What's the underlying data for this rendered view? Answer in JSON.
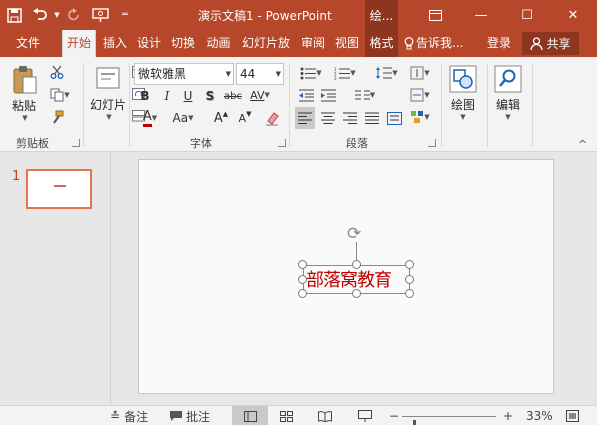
{
  "window": {
    "title": "演示文稿1 - PowerPoint",
    "context_tab": "绘...",
    "ribbon_display_icon": "ribbon-display-icon",
    "minimize_glyph": "—",
    "maximize_glyph": "☐",
    "close_glyph": "✕"
  },
  "qat": {
    "save_icon": "save-icon",
    "undo_icon": "undo-icon",
    "redo_icon": "redo-icon",
    "start_from_beginning_icon": "slideshow-icon",
    "customize_icon": "customize-qat-icon"
  },
  "tabs": [
    {
      "label": "文件"
    },
    {
      "label": "开始",
      "active": true
    },
    {
      "label": "插入"
    },
    {
      "label": "设计"
    },
    {
      "label": "切换"
    },
    {
      "label": "动画"
    },
    {
      "label": "幻灯片放"
    },
    {
      "label": "审阅"
    },
    {
      "label": "视图"
    },
    {
      "label": "格式"
    },
    {
      "label": "告诉我..."
    },
    {
      "label": "登录"
    }
  ],
  "share": {
    "label": "共享"
  },
  "ribbon": {
    "clipboard": {
      "group_label": "剪贴板",
      "paste_label": "粘贴"
    },
    "slides": {
      "new_slide_label": "幻灯片"
    },
    "font": {
      "group_label": "字体",
      "font_name": "微软雅黑",
      "font_size": "44",
      "bold": "B",
      "italic": "I",
      "underline": "U",
      "shadow": "S",
      "strike": "abc",
      "spacing": "AV",
      "font_color_letter": "A",
      "change_case": "Aa",
      "grow": "A",
      "shrink": "A"
    },
    "paragraph": {
      "group_label": "段落"
    },
    "drawing": {
      "label": "绘图"
    },
    "editing": {
      "label": "编辑"
    }
  },
  "thumbnails": [
    {
      "number": "1"
    }
  ],
  "slide": {
    "textbox_text": "部落窝教育",
    "text_color": "#c00000"
  },
  "status": {
    "notes_label": "备注",
    "comments_label": "批注",
    "zoom_percent": "33%",
    "zoom_level": 0.33,
    "zoom_minus": "−",
    "zoom_plus": "+"
  },
  "colors": {
    "accent": "#b7472a",
    "accent_dark": "#8e3520",
    "ribbon_bg": "#f3f3f3"
  }
}
